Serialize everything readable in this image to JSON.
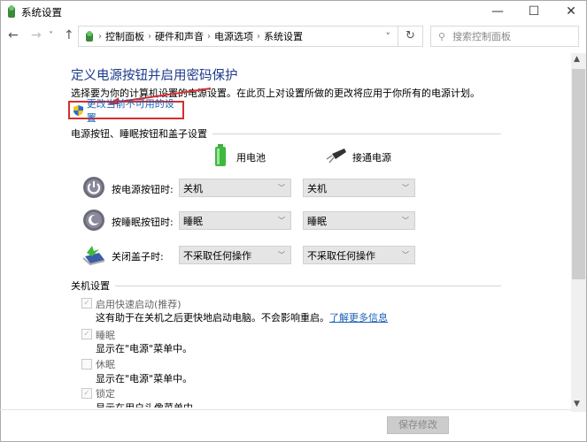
{
  "window": {
    "title": "系统设置",
    "minimize": "—",
    "maximize": "☐",
    "close": "✕"
  },
  "nav": {
    "back": "←",
    "forward": "→",
    "recent": "˅",
    "up": "↑",
    "refresh": "↻",
    "dropdown": "˅"
  },
  "breadcrumb": [
    "控制面板",
    "硬件和声音",
    "电源选项",
    "系统设置"
  ],
  "search": {
    "placeholder": "搜索控制面板"
  },
  "main": {
    "title": "定义电源按钮并启用密码保护",
    "description": "选择要为你的计算机设置的电源设置。在此页上对设置所做的更改将应用于你所有的电源计划。",
    "change_link": "更改当前不可用的设置",
    "section1": "电源按钮、睡眠按钮和盖子设置",
    "col_battery": "用电池",
    "col_plugged": "接通电源",
    "rows": [
      {
        "label": "按电源按钮时:",
        "battery": "关机",
        "plugged": "关机"
      },
      {
        "label": "按睡眠按钮时:",
        "battery": "睡眠",
        "plugged": "睡眠"
      },
      {
        "label": "关闭盖子时:",
        "battery": "不采取任何操作",
        "plugged": "不采取任何操作"
      }
    ],
    "section2": "关机设置",
    "options": [
      {
        "label": "启用快速启动(推荐)",
        "desc": "这有助于在关机之后更快地启动电脑。不会影响重启。",
        "link": "了解更多信息",
        "checked": true
      },
      {
        "label": "睡眠",
        "desc": "显示在\"电源\"菜单中。",
        "checked": true
      },
      {
        "label": "休眠",
        "desc": "显示在\"电源\"菜单中。",
        "checked": false
      },
      {
        "label": "锁定",
        "desc": "显示在用户头像菜单中。",
        "checked": true
      }
    ],
    "save": "保存修改"
  },
  "colors": {
    "accent": "#1e3a8a",
    "link": "#1a5fb4",
    "highlight": "#d32f2f"
  }
}
